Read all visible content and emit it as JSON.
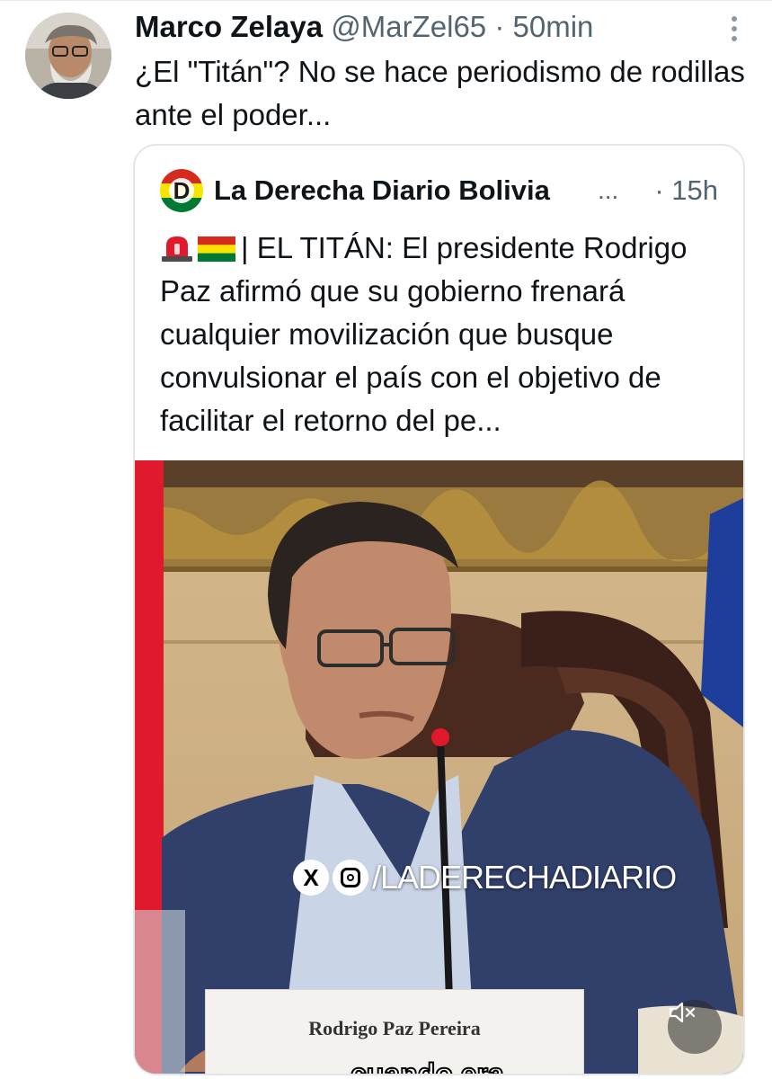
{
  "tweet": {
    "display_name": "Marco Zelaya",
    "handle": "@MarZel65",
    "separator": "·",
    "time": "50min",
    "text": "¿El \"Titán\"? No se hace periodismo de rodillas ante el poder..."
  },
  "quoted": {
    "account_name": "La Derecha Diario Bolivia",
    "ellipsis": "...",
    "time": "· 15h",
    "text": "| EL TITÁN: El presidente Rodrigo Paz afirmó que su gobierno frenará cualquier movilización que busque convulsionar el país con el objetivo de facilitar el retorno del pe...",
    "emoji_icons": [
      "siren-icon",
      "bolivia-flag-icon"
    ],
    "logo_letter": "D"
  },
  "video": {
    "watermark": "/LADERECHADIARIO",
    "watermark_x": "X",
    "nameplate": "Rodrigo Paz Pereira",
    "caption": "cuando era",
    "mute_icon": "volume-muted-icon"
  },
  "colors": {
    "text_primary": "#0f1419",
    "text_secondary": "#536471",
    "border": "#e3e6e8",
    "accent_red": "#e1192d"
  }
}
